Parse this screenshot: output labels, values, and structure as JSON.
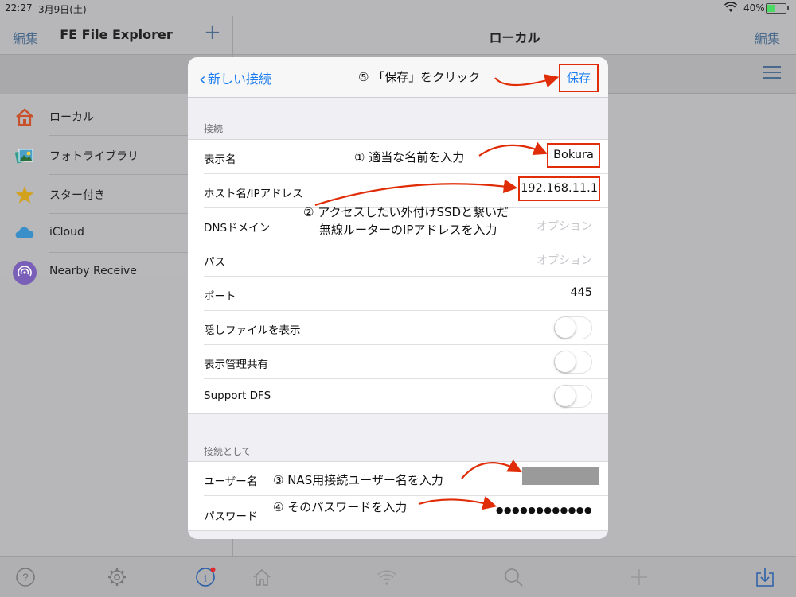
{
  "status": {
    "time": "22:27",
    "date": "3月9日(土)",
    "battery": "40%"
  },
  "left": {
    "edit_label": "編集",
    "title": "FE File Explorer",
    "add_label": "+",
    "items": [
      {
        "label": "ローカル",
        "icon": "house-icon"
      },
      {
        "label": "フォトライブラリ",
        "icon": "photos-icon"
      },
      {
        "label": "スター付き",
        "icon": "star-icon"
      },
      {
        "label": "iCloud",
        "icon": "cloud-icon"
      },
      {
        "label": "Nearby Receive",
        "icon": "airdrop-icon"
      }
    ]
  },
  "right": {
    "title": "ローカル",
    "edit_label": "編集"
  },
  "modal": {
    "back_label": "新しい接続",
    "save_label": "保存",
    "annotations": {
      "a5": "⑤ 「保存」をクリック",
      "a1": "① 適当な名前を入力",
      "a2_line1": "② アクセスしたい外付けSSDと繋いだ",
      "a2_line2": "無線ルーターのIPアドレスを入力",
      "a3": "③ NAS用接続ユーザー名を入力",
      "a4": "④ そのパスワードを入力"
    },
    "section_connection": "接続",
    "rows": {
      "display_name": {
        "label": "表示名",
        "value": "Bokura"
      },
      "host": {
        "label": "ホスト名/IPアドレス",
        "value": "192.168.11.1"
      },
      "dns": {
        "label": "DNSドメイン",
        "placeholder": "オプション"
      },
      "path": {
        "label": "パス",
        "placeholder": "オプション"
      },
      "port": {
        "label": "ポート",
        "value": "445"
      },
      "hidden": {
        "label": "隠しファイルを表示",
        "on": false
      },
      "admin_share": {
        "label": "表示管理共有",
        "on": false
      },
      "dfs": {
        "label": "Support DFS",
        "on": false
      }
    },
    "section_connect_as": "接続として",
    "user": {
      "label": "ユーザー名"
    },
    "password": {
      "label": "パスワード",
      "value": "●●●●●●●●●●●●"
    },
    "annotation_color": "#e02d08",
    "accent_color": "#1a7cf0"
  },
  "tabbar": [
    "help-icon",
    "settings-icon",
    "info-icon",
    "home-icon",
    "wifi-icon",
    "search-icon",
    "add-icon",
    "download-icon"
  ]
}
